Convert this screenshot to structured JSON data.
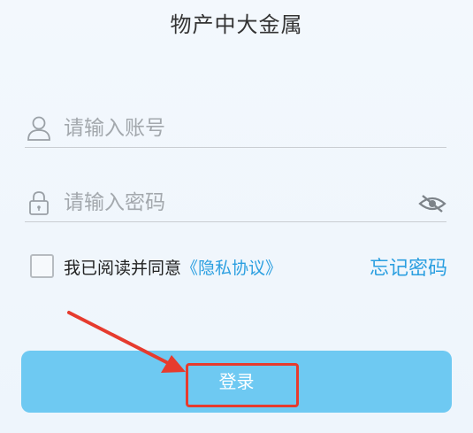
{
  "header": {
    "title": "物产中大金属"
  },
  "account": {
    "placeholder": "请输入账号",
    "icon": "user-icon"
  },
  "password": {
    "placeholder": "请输入密码",
    "icon": "lock-icon",
    "toggle_icon": "eye-off-icon"
  },
  "agreement": {
    "text": "我已阅读并同意",
    "link": "《隐私协议》",
    "checked": false
  },
  "forgot_password": {
    "label": "忘记密码"
  },
  "login_button": {
    "label": "登录"
  },
  "colors": {
    "accent": "#2b9fe0",
    "button": "#6ec9f2",
    "annotation": "#e63b2e"
  }
}
